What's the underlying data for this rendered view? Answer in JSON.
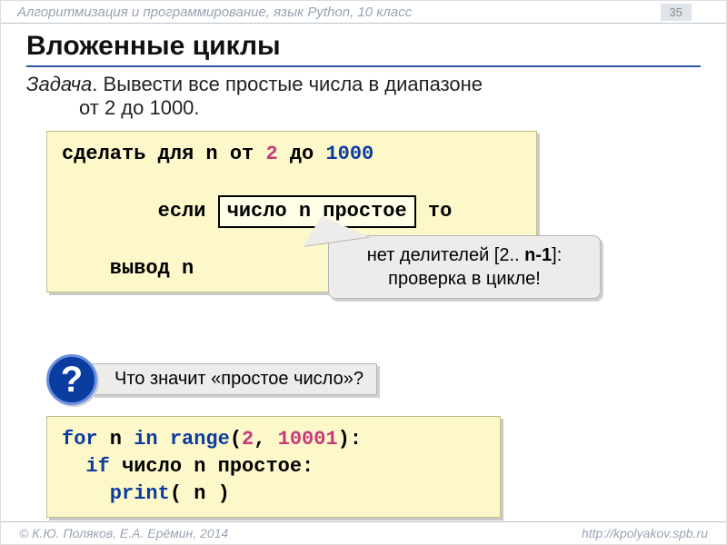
{
  "header": {
    "course": "Алгоритмизация и программирование, язык Python, 10 класс",
    "page": "35"
  },
  "title": "Вложенные циклы",
  "task": {
    "label": "Задача",
    "line1": ". Вывести все простые числа в диапазоне",
    "line2": "от 2 до 1000."
  },
  "pseudo": {
    "l1a": "сделать для n от ",
    "l1_num1": "2",
    "l1b": " до ",
    "l1_num2": "1000",
    "l2a": "  если ",
    "l2_box": "число n простое",
    "l2b": " то",
    "l3": "    вывод n"
  },
  "callout": {
    "part1": "нет делителей [2.. ",
    "bold": "n-1",
    "part2": "]:",
    "line2": "проверка в цикле!"
  },
  "question": {
    "mark": "?",
    "text": "Что значит «простое число»?"
  },
  "python": {
    "kw_for": "for",
    "n": " n ",
    "kw_in": "in",
    "sp": " ",
    "range": "range",
    "p1": "(",
    "a1": "2",
    "comma": ", ",
    "a2": "10001",
    "p2": "):",
    "kw_if": "  if",
    "cond": " число n простое",
    "colon": ":",
    "print": "    print",
    "paren": "( n )"
  },
  "footer": {
    "left": "© К.Ю. Поляков, Е.А. Ерёмин, 2014",
    "right": "http://kpolyakov.spb.ru"
  }
}
